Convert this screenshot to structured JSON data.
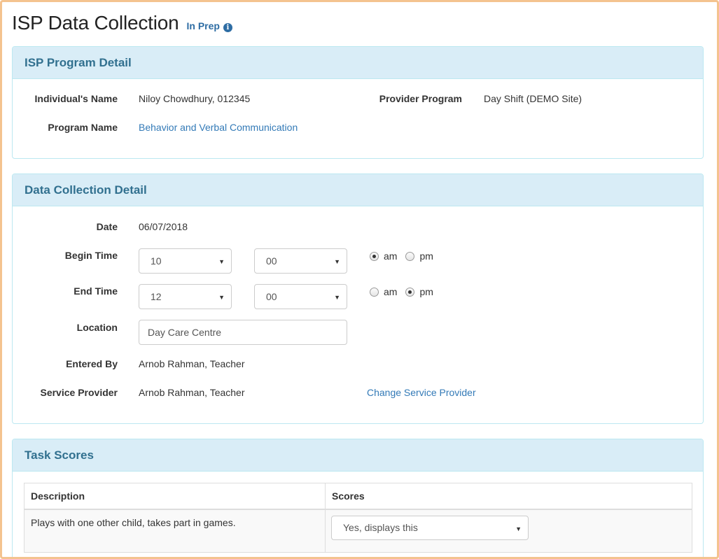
{
  "header": {
    "title": "ISP Data Collection",
    "status": "In Prep",
    "info_icon": "i"
  },
  "program_detail": {
    "heading": "ISP Program Detail",
    "individual_label": "Individual's Name",
    "individual_value": "Niloy Chowdhury, 012345",
    "provider_program_label": "Provider Program",
    "provider_program_value": "Day Shift (DEMO Site)",
    "program_name_label": "Program Name",
    "program_name_value": "Behavior and Verbal Communication"
  },
  "collection_detail": {
    "heading": "Data Collection Detail",
    "date_label": "Date",
    "date_value": "06/07/2018",
    "begin_label": "Begin Time",
    "begin_hour": "10",
    "begin_minute": "00",
    "begin_ampm": "am",
    "end_label": "End Time",
    "end_hour": "12",
    "end_minute": "00",
    "end_ampm": "pm",
    "am_label": "am",
    "pm_label": "pm",
    "location_label": "Location",
    "location_value": "Day Care Centre",
    "entered_by_label": "Entered By",
    "entered_by_value": "Arnob Rahman, Teacher",
    "service_provider_label": "Service Provider",
    "service_provider_value": "Arnob Rahman, Teacher",
    "change_provider_link": "Change Service Provider"
  },
  "task_scores": {
    "heading": "Task Scores",
    "columns": [
      "Description",
      "Scores"
    ],
    "rows": [
      {
        "description": "Plays with one other child, takes part in games.",
        "score": "Yes, displays this"
      }
    ]
  },
  "colors": {
    "panel_heading_bg": "#d9edf7",
    "panel_heading_text": "#31708f",
    "link": "#337ab7",
    "frame_border": "#f4c38f"
  }
}
